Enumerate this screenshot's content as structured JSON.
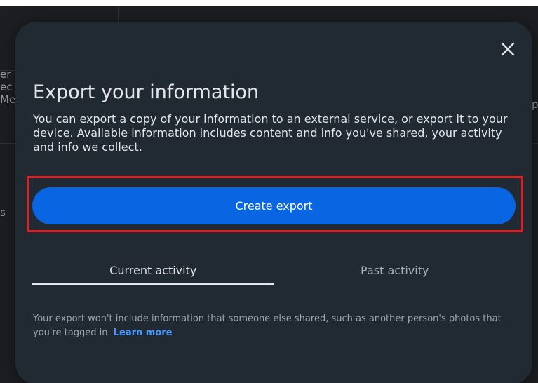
{
  "background": {
    "left_fragments": [
      "er",
      "ec",
      "Me",
      "s"
    ],
    "right_fragment": "p"
  },
  "modal": {
    "close_icon": "close-icon",
    "title": "Export your information",
    "description": "You can export a copy of your information to an external service, or export it to your device. Available information includes content and info you've shared, your activity and info we collect.",
    "create_export_label": "Create export",
    "tabs": [
      {
        "label": "Current activity",
        "active": true
      },
      {
        "label": "Past activity",
        "active": false
      }
    ],
    "footnote": "Your export won't include information that someone else shared, such as another person's photos that you're tagged in.",
    "learn_more": "Learn more"
  },
  "colors": {
    "backdrop": "#1c1e21",
    "modal_bg": "#212a33",
    "primary_button": "#0a65e3",
    "highlight_border": "#e41e1e",
    "link": "#4599ff"
  }
}
